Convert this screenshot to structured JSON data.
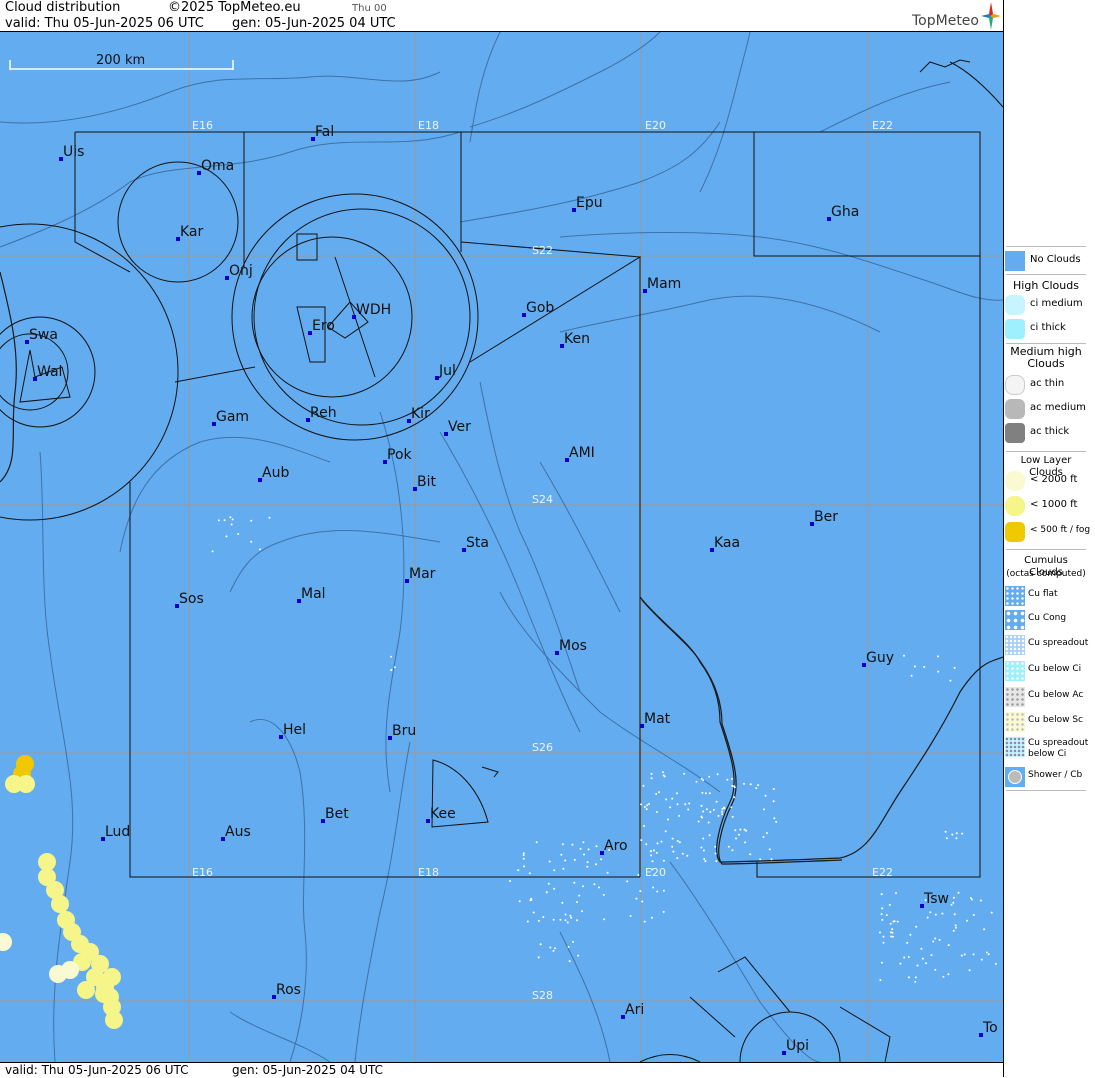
{
  "header": {
    "product": "Cloud distribution",
    "copyright": "©2025 TopMeteo.eu",
    "day_code": "Thu 00",
    "valid_text": "valid:  Thu  05-Jun-2025  06 UTC",
    "gen_text": "gen: 05-Jun-2025 04 UTC",
    "brand": "TopMeteo"
  },
  "footer": {
    "valid_text": "valid:  Thu  05-Jun-2025  06 UTC",
    "gen_text": "gen: 05-Jun-2025 04 UTC"
  },
  "scale": {
    "label": "200 km"
  },
  "colors": {
    "sea": "#64acf0",
    "line": "#1a1a1a",
    "grid": "#9a9a9a",
    "station": "#0000cc",
    "low_cloud": "#f5f58a",
    "fog": "#f0c800"
  },
  "grid_labels": {
    "lon_top": [
      "E16",
      "E18",
      "E20",
      "E22"
    ],
    "lon_bottom": [
      "E16",
      "E18",
      "E20",
      "E22"
    ],
    "lat": [
      "S22",
      "S24",
      "S26",
      "S28"
    ]
  },
  "stations": [
    {
      "name": "Uis"
    },
    {
      "name": "Fal"
    },
    {
      "name": "Oma"
    },
    {
      "name": "Kar"
    },
    {
      "name": "Epu"
    },
    {
      "name": "Gha"
    },
    {
      "name": "Onj"
    },
    {
      "name": "Mam"
    },
    {
      "name": "Swa"
    },
    {
      "name": "Ero"
    },
    {
      "name": "WDH"
    },
    {
      "name": "Gob"
    },
    {
      "name": "Ken"
    },
    {
      "name": "Wal"
    },
    {
      "name": "Jul"
    },
    {
      "name": "Gam"
    },
    {
      "name": "Reh"
    },
    {
      "name": "Kir"
    },
    {
      "name": "Ver"
    },
    {
      "name": "AMI"
    },
    {
      "name": "Pok"
    },
    {
      "name": "Aub"
    },
    {
      "name": "Bit"
    },
    {
      "name": "Ber"
    },
    {
      "name": "Sta"
    },
    {
      "name": "Kaa"
    },
    {
      "name": "Mar"
    },
    {
      "name": "Sos"
    },
    {
      "name": "Mal"
    },
    {
      "name": "Mos"
    },
    {
      "name": "Guy"
    },
    {
      "name": "Mat"
    },
    {
      "name": "Hel"
    },
    {
      "name": "Bru"
    },
    {
      "name": "Bet"
    },
    {
      "name": "Kee"
    },
    {
      "name": "Lud"
    },
    {
      "name": "Aus"
    },
    {
      "name": "Aro"
    },
    {
      "name": "Tsw"
    },
    {
      "name": "Ros"
    },
    {
      "name": "Ari"
    },
    {
      "name": "To"
    },
    {
      "name": "Upi"
    }
  ],
  "legend": {
    "no_clouds": "No Clouds",
    "high_title": "High Clouds",
    "ci_medium": "ci medium",
    "ci_thick": "ci thick",
    "medium_title": "Medium high Clouds",
    "ac_thin": "ac thin",
    "ac_medium": "ac medium",
    "ac_thick": "ac thick",
    "low_title": "Low Layer Clouds",
    "low_2000": "< 2000 ft",
    "low_1000": "< 1000 ft",
    "low_500": "< 500 ft / fog",
    "cu_title": "Cumulus Clouds",
    "cu_sub": "(octas computed)",
    "cu_flat": "Cu flat",
    "cu_cong": "Cu Cong",
    "cu_spread": "Cu spreadout",
    "cu_below_ci": "Cu below Ci",
    "cu_below_ac": "Cu below Ac",
    "cu_below_sc": "Cu below Sc",
    "cu_spread_ci": "Cu spreadout below Ci",
    "shower": "Shower / Cb"
  }
}
